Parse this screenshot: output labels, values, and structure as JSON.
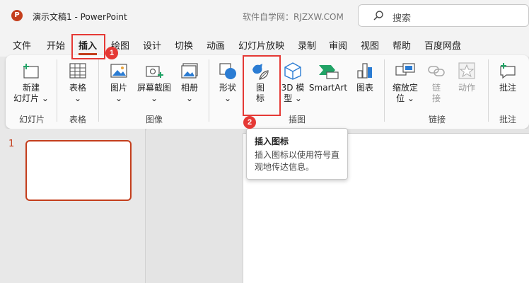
{
  "titlebar": {
    "app_logo": "P",
    "doc_title": "演示文稿1  -  PowerPoint",
    "site_mark": "软件自学网：RJZXW.COM",
    "search_placeholder": "搜索"
  },
  "tabs": [
    "文件",
    "开始",
    "插入",
    "绘图",
    "设计",
    "切换",
    "动画",
    "幻灯片放映",
    "录制",
    "审阅",
    "视图",
    "帮助",
    "百度网盘"
  ],
  "active_tab": "插入",
  "badges": {
    "one": "1",
    "two": "2"
  },
  "ribbon": {
    "new_slide": {
      "line1": "新建",
      "line2": "幻灯片",
      "arrow": "⌄"
    },
    "table": {
      "label": "表格",
      "arrow": "⌄"
    },
    "picture": {
      "label": "图片",
      "arrow": "⌄"
    },
    "screenshot": {
      "label": "屏幕截图",
      "arrow": "⌄"
    },
    "album": {
      "label": "相册",
      "arrow": "⌄"
    },
    "shapes": {
      "label": "形状",
      "arrow": "⌄"
    },
    "icons": {
      "line1": "图",
      "line2": "标"
    },
    "model3d": {
      "line1": "3D 模",
      "line2": "型 ⌄"
    },
    "smartart": {
      "label": "SmartArt"
    },
    "chart": {
      "label": "图表"
    },
    "zoom": {
      "line1": "缩放定",
      "line2": "位 ⌄"
    },
    "link": {
      "line1": "链",
      "line2": "接"
    },
    "action": {
      "label": "动作"
    },
    "comment": {
      "label": "批注"
    },
    "groups": {
      "slides": "幻灯片",
      "tables": "表格",
      "images": "图像",
      "illustrations": "插图",
      "links": "链接",
      "comments": "批注"
    }
  },
  "slide_pane": {
    "number": "1"
  },
  "tooltip": {
    "title": "插入图标",
    "body": "插入图标以使用符号直观地传达信息。"
  },
  "colors": {
    "accent": "#c43e1c",
    "highlight": "#e53935",
    "icon_blue": "#2b7cd3",
    "icon_green": "#21a366"
  }
}
